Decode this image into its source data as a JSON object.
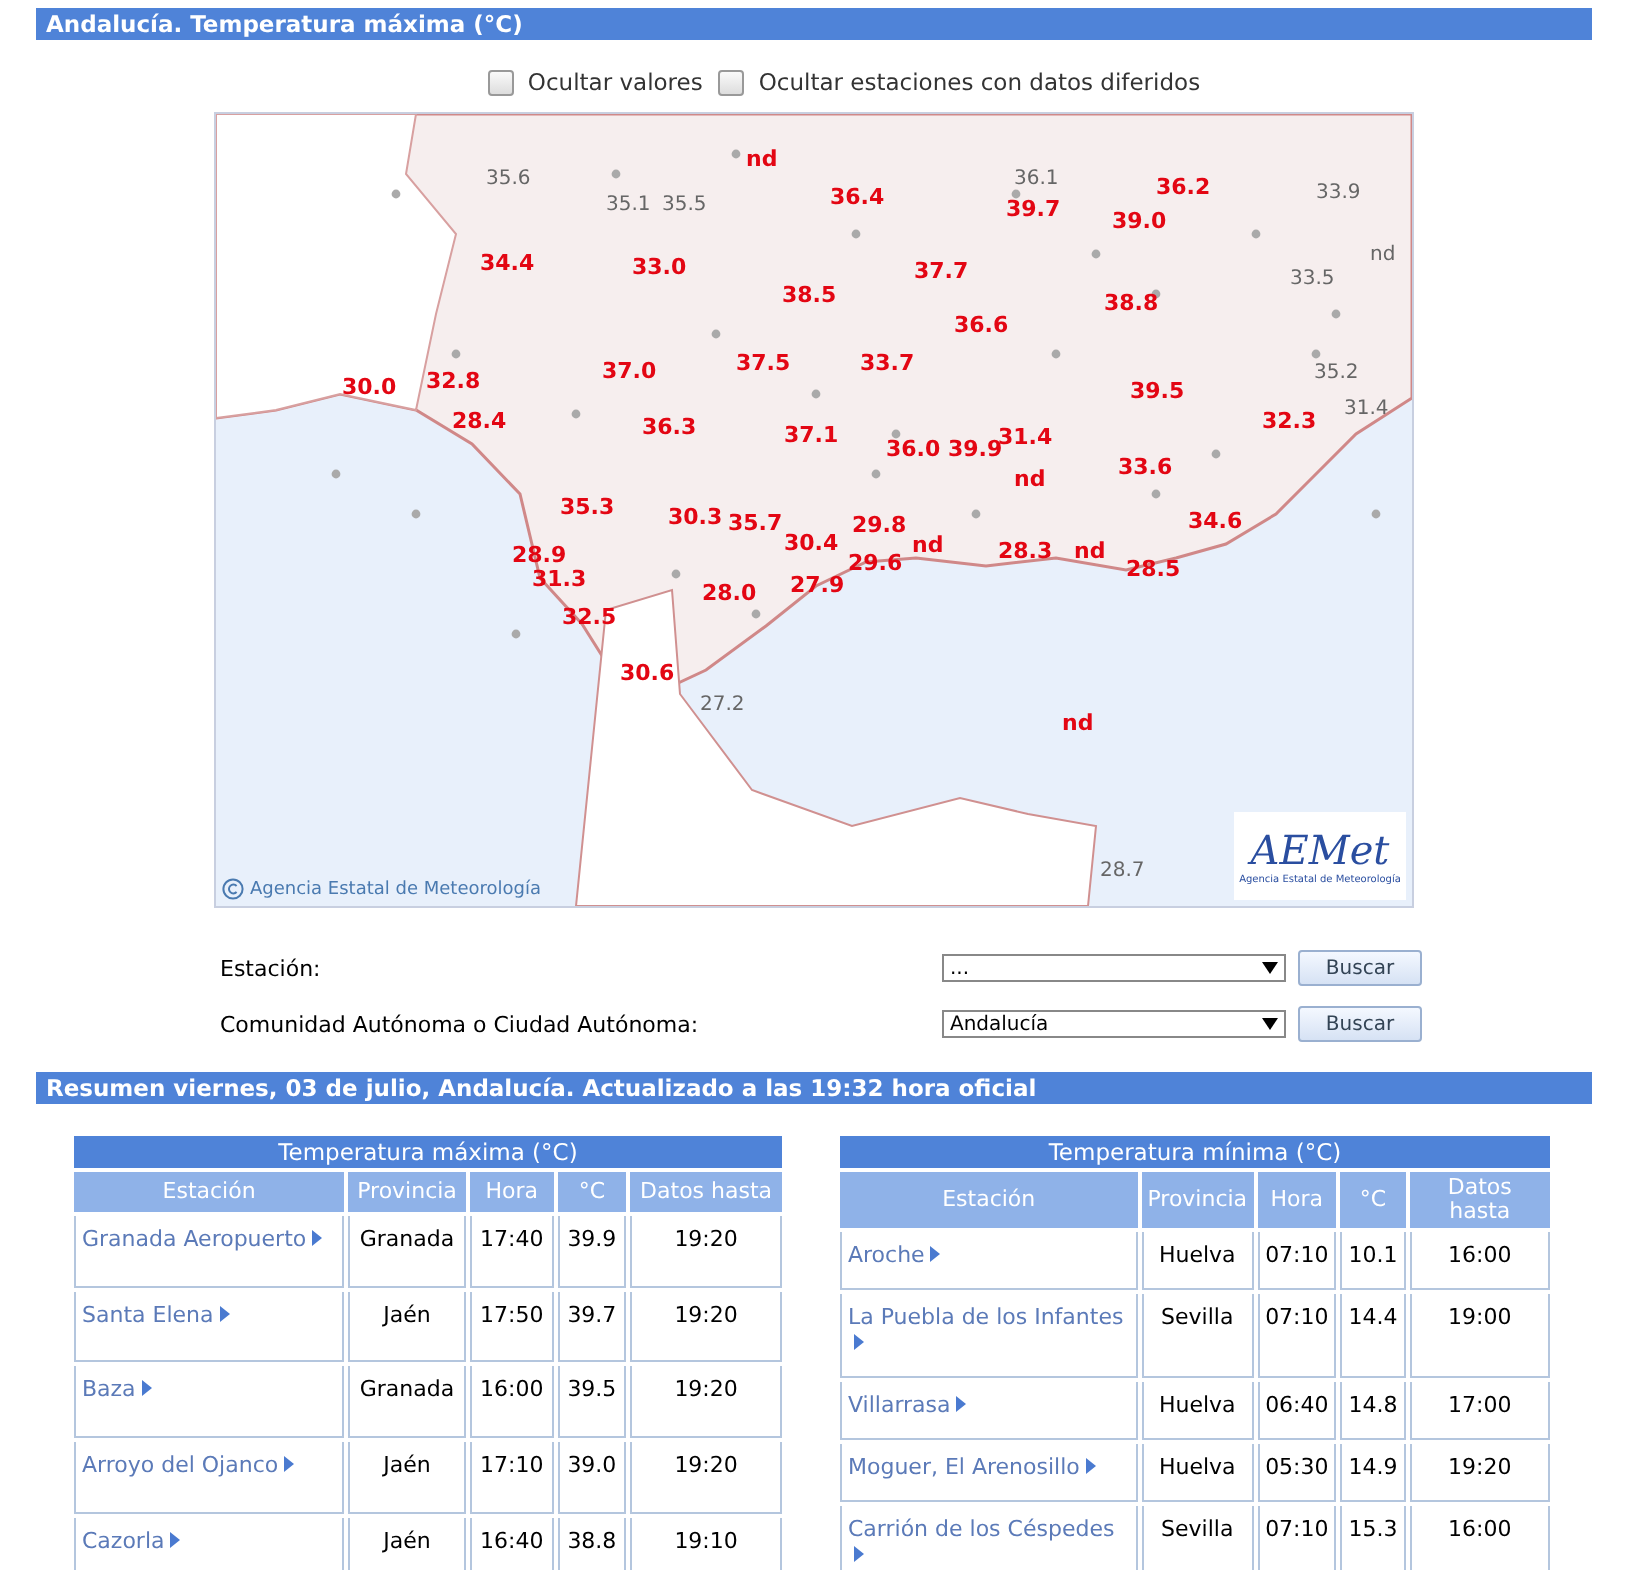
{
  "header": {
    "title": "Andalucía. Temperatura máxima (°C)"
  },
  "options": [
    {
      "label": "Ocultar valores",
      "checked": false
    },
    {
      "label": "Ocultar estaciones con datos diferidos",
      "checked": false
    }
  ],
  "map": {
    "values": [
      {
        "text": "35.6",
        "kind": "other"
      },
      {
        "text": "nd",
        "kind": "own"
      },
      {
        "text": "35.1",
        "kind": "other"
      },
      {
        "text": "35.5",
        "kind": "other"
      },
      {
        "text": "36.4",
        "kind": "own"
      },
      {
        "text": "36.1",
        "kind": "other"
      },
      {
        "text": "39.7",
        "kind": "own"
      },
      {
        "text": "36.2",
        "kind": "own"
      },
      {
        "text": "33.9",
        "kind": "other"
      },
      {
        "text": "34.4",
        "kind": "own"
      },
      {
        "text": "33.0",
        "kind": "own"
      },
      {
        "text": "37.7",
        "kind": "own"
      },
      {
        "text": "39.0",
        "kind": "own"
      },
      {
        "text": "nd",
        "kind": "other"
      },
      {
        "text": "33.5",
        "kind": "other"
      },
      {
        "text": "38.5",
        "kind": "own"
      },
      {
        "text": "38.8",
        "kind": "own"
      },
      {
        "text": "36.6",
        "kind": "own"
      },
      {
        "text": "37.0",
        "kind": "own"
      },
      {
        "text": "37.5",
        "kind": "own"
      },
      {
        "text": "33.7",
        "kind": "own"
      },
      {
        "text": "35.2",
        "kind": "other"
      },
      {
        "text": "30.0",
        "kind": "own"
      },
      {
        "text": "32.8",
        "kind": "own"
      },
      {
        "text": "39.5",
        "kind": "own"
      },
      {
        "text": "28.4",
        "kind": "own"
      },
      {
        "text": "36.3",
        "kind": "own"
      },
      {
        "text": "37.1",
        "kind": "own"
      },
      {
        "text": "32.3",
        "kind": "own"
      },
      {
        "text": "31.4",
        "kind": "other"
      },
      {
        "text": "36.0",
        "kind": "own"
      },
      {
        "text": "39.9",
        "kind": "own"
      },
      {
        "text": "31.4",
        "kind": "own"
      },
      {
        "text": "nd",
        "kind": "own"
      },
      {
        "text": "33.6",
        "kind": "own"
      },
      {
        "text": "35.3",
        "kind": "own"
      },
      {
        "text": "30.3",
        "kind": "own"
      },
      {
        "text": "35.7",
        "kind": "own"
      },
      {
        "text": "28.9",
        "kind": "own"
      },
      {
        "text": "29.8",
        "kind": "own"
      },
      {
        "text": "30.4",
        "kind": "own"
      },
      {
        "text": "34.6",
        "kind": "own"
      },
      {
        "text": "29.6",
        "kind": "own"
      },
      {
        "text": "nd",
        "kind": "own"
      },
      {
        "text": "28.3",
        "kind": "own"
      },
      {
        "text": "nd",
        "kind": "own"
      },
      {
        "text": "31.3",
        "kind": "own"
      },
      {
        "text": "28.0",
        "kind": "own"
      },
      {
        "text": "27.9",
        "kind": "own"
      },
      {
        "text": "28.5",
        "kind": "own"
      },
      {
        "text": "32.5",
        "kind": "own"
      },
      {
        "text": "30.6",
        "kind": "own"
      },
      {
        "text": "27.2",
        "kind": "other"
      },
      {
        "text": "nd",
        "kind": "own"
      },
      {
        "text": "28.7",
        "kind": "other"
      }
    ],
    "credit": "Agencia Estatal de Meteorología",
    "logo": {
      "mark": "AEMet",
      "caption": "Agencia Estatal de Meteorología"
    }
  },
  "search": [
    {
      "label": "Estación:",
      "value": "...",
      "button": "Buscar"
    },
    {
      "label": "Comunidad Autónoma o Ciudad Autónoma:",
      "value": "Andalucía",
      "button": "Buscar"
    }
  ],
  "summary": {
    "title": "Resumen viernes, 03 de julio, Andalucía. Actualizado a las 19:32 hora oficial"
  },
  "tables": [
    {
      "title": "Temperatura máxima (°C)",
      "columns": [
        "Estación",
        "Provincia",
        "Hora",
        "°C",
        "Datos hasta"
      ],
      "rows": [
        [
          "Granada Aeropuerto",
          "Granada",
          "17:40",
          "39.9",
          "19:20"
        ],
        [
          "Santa Elena",
          "Jaén",
          "17:50",
          "39.7",
          "19:20"
        ],
        [
          "Baza",
          "Granada",
          "16:00",
          "39.5",
          "19:20"
        ],
        [
          "Arroyo del Ojanco",
          "Jaén",
          "17:10",
          "39.0",
          "19:20"
        ],
        [
          "Cazorla",
          "Jaén",
          "16:40",
          "38.8",
          "19:10"
        ]
      ]
    },
    {
      "title": "Temperatura mínima (°C)",
      "columns": [
        "Estación",
        "Provincia",
        "Hora",
        "°C",
        "Datos hasta"
      ],
      "rows": [
        [
          "Aroche",
          "Huelva",
          "07:10",
          "10.1",
          "16:00"
        ],
        [
          "La Puebla de los Infantes",
          "Sevilla",
          "07:10",
          "14.4",
          "19:00"
        ],
        [
          "Villarrasa",
          "Huelva",
          "06:40",
          "14.8",
          "17:00"
        ],
        [
          "Moguer, El Arenosillo",
          "Huelva",
          "05:30",
          "14.9",
          "19:20"
        ],
        [
          "Carrión de los Céspedes",
          "Sevilla",
          "07:10",
          "15.3",
          "16:00"
        ]
      ]
    }
  ]
}
